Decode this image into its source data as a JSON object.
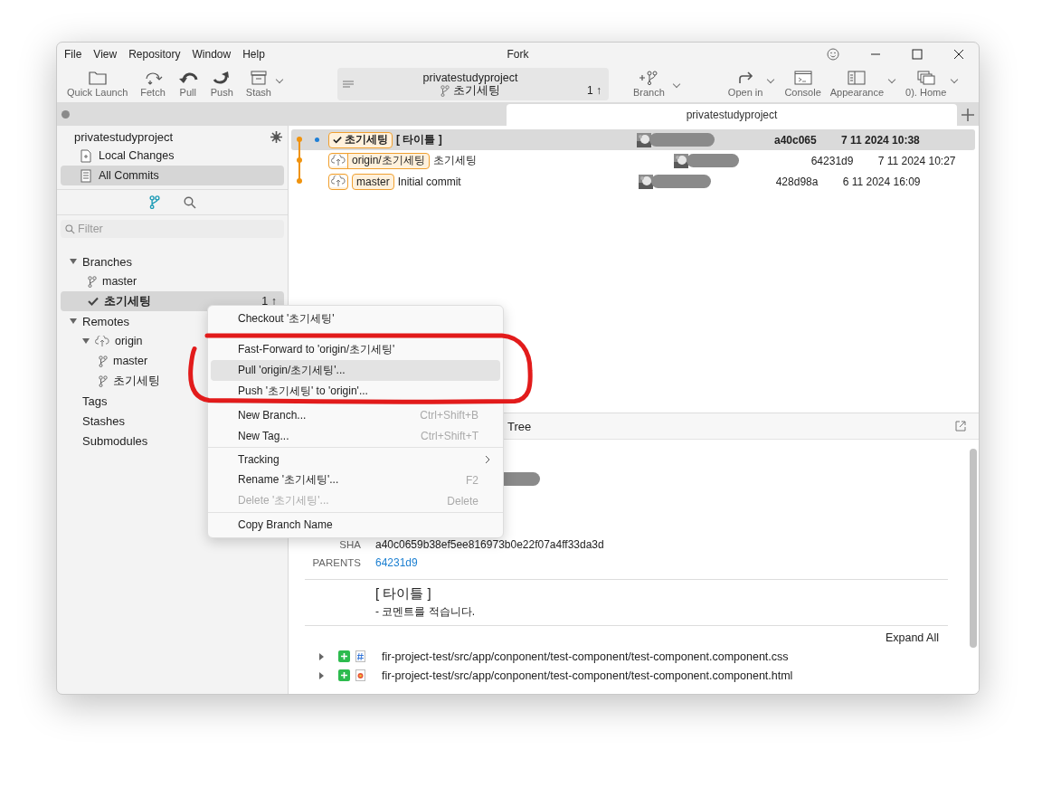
{
  "window": {
    "title": "Fork",
    "menu": [
      "File",
      "View",
      "Repository",
      "Window",
      "Help"
    ]
  },
  "toolbar": {
    "left": [
      {
        "kind": "folder",
        "label": "Quick Launch",
        "dropdown": false
      },
      {
        "kind": "fetch",
        "label": "Fetch",
        "dropdown": false
      },
      {
        "kind": "pull",
        "label": "Pull",
        "dropdown": false
      },
      {
        "kind": "push",
        "label": "Push",
        "dropdown": false
      },
      {
        "kind": "stash",
        "label": "Stash",
        "dropdown": true
      }
    ],
    "repo": {
      "name": "privatestudyproject",
      "branch": "초기세팅",
      "ahead": "1 ↑"
    },
    "right": [
      {
        "kind": "branch",
        "label": "Branch",
        "dropdown": true
      },
      {
        "kind": "openin",
        "label": "Open in",
        "dropdown": true
      },
      {
        "kind": "console",
        "label": "Console",
        "dropdown": false
      },
      {
        "kind": "appearance",
        "label": "Appearance",
        "dropdown": true
      },
      {
        "kind": "home",
        "label": "0). Home",
        "dropdown": true
      }
    ]
  },
  "tabs": [
    {
      "label": "privatestudyproject",
      "selected": true
    }
  ],
  "sidebar": {
    "repo_name": "privatestudyproject",
    "nav": [
      {
        "kind": "changes",
        "label": "Local Changes",
        "selected": false
      },
      {
        "kind": "commits",
        "label": "All Commits",
        "selected": true
      }
    ],
    "modes": [
      {
        "kind": "branches",
        "selected": true
      },
      {
        "kind": "search",
        "selected": false
      }
    ],
    "filter": {
      "placeholder": "Filter"
    },
    "tree": [
      {
        "kind": "section",
        "label": "Branches",
        "expanded": true,
        "children": [
          {
            "kind": "branch",
            "label": "master",
            "current": false,
            "selected": false
          },
          {
            "kind": "branch",
            "label": "초기세팅",
            "current": true,
            "selected": true,
            "ahead": "1 ↑"
          }
        ]
      },
      {
        "kind": "section",
        "label": "Remotes",
        "expanded": true,
        "children": [
          {
            "kind": "remote",
            "label": "origin",
            "expanded": true,
            "children": [
              {
                "kind": "branch",
                "label": "master",
                "current": false,
                "selected": false
              },
              {
                "kind": "branch",
                "label": "초기세팅",
                "current": false,
                "selected": false
              }
            ]
          }
        ]
      },
      {
        "kind": "section",
        "label": "Tags"
      },
      {
        "kind": "section",
        "label": "Stashes"
      },
      {
        "kind": "section",
        "label": "Submodules"
      }
    ]
  },
  "commits": [
    {
      "selected": true,
      "head": true,
      "refs": [
        {
          "kind": "local",
          "label": "초기세팅",
          "current": true
        }
      ],
      "message": "[ 타이틀 ]",
      "sha": "a40c065",
      "date": "7 11 2024 10:38"
    },
    {
      "selected": false,
      "head": false,
      "refs": [
        {
          "kind": "remote",
          "label": "origin/초기세팅"
        }
      ],
      "message": "초기세팅",
      "sha": "64231d9",
      "date": "7 11 2024 10:27"
    },
    {
      "selected": false,
      "head": false,
      "refs": [
        {
          "kind": "remote"
        },
        {
          "kind": "local",
          "label": "master",
          "current": false
        }
      ],
      "message": "Initial commit",
      "sha": "428d98a",
      "date": "6 11 2024 16:09"
    }
  ],
  "detail": {
    "tab": "Tree",
    "sha_label": "SHA",
    "sha": "a40c0659b38ef5ee816973b0e22f07a4ff33da3d",
    "parents_label": "PARENTS",
    "parent": "64231d9",
    "title": "[ 타이틀 ]",
    "body": "-  코멘트를 적습니다.",
    "expand_all": "Expand All",
    "files": [
      {
        "added": true,
        "kind": "css",
        "path": "fir-project-test/src/app/conponent/test-component/test-component.component.css"
      },
      {
        "added": true,
        "kind": "html",
        "path": "fir-project-test/src/app/conponent/test-component/test-component.component.html"
      }
    ]
  },
  "context_menu": [
    {
      "kind": "item",
      "label": "Checkout '초기세팅'",
      "selected": false,
      "disabled": false
    },
    {
      "kind": "separator"
    },
    {
      "kind": "item",
      "label": "Fast-Forward to 'origin/초기세팅'",
      "selected": false,
      "disabled": false
    },
    {
      "kind": "item",
      "label": "Pull 'origin/초기세팅'...",
      "selected": true,
      "disabled": false
    },
    {
      "kind": "item",
      "label": "Push '초기세팅' to 'origin'...",
      "selected": false,
      "disabled": false
    },
    {
      "kind": "separator"
    },
    {
      "kind": "item",
      "label": "New Branch...",
      "shortcut": "Ctrl+Shift+B",
      "selected": false,
      "disabled": false
    },
    {
      "kind": "item",
      "label": "New Tag...",
      "shortcut": "Ctrl+Shift+T",
      "selected": false,
      "disabled": false
    },
    {
      "kind": "separator"
    },
    {
      "kind": "item",
      "label": "Tracking",
      "submenu": true,
      "selected": false,
      "disabled": false
    },
    {
      "kind": "item",
      "label": "Rename '초기세팅'...",
      "shortcut": "F2",
      "selected": false,
      "disabled": false
    },
    {
      "kind": "item",
      "label": "Delete '초기세팅'...",
      "shortcut": "Delete",
      "selected": false,
      "disabled": true
    },
    {
      "kind": "separator"
    },
    {
      "kind": "item",
      "label": "Copy Branch Name",
      "selected": false,
      "disabled": false
    }
  ]
}
